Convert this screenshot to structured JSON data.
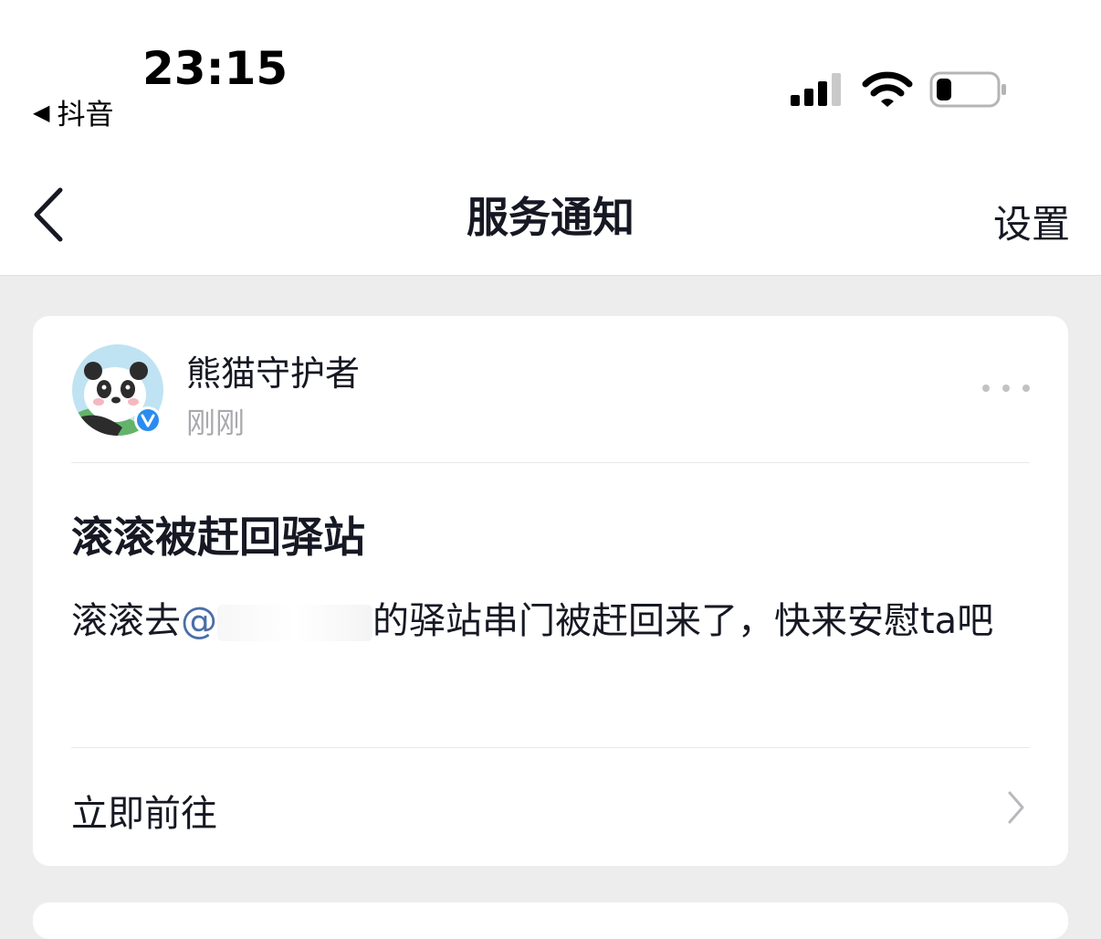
{
  "status_bar": {
    "time": "23:15",
    "back_app_label": "抖音"
  },
  "nav": {
    "title": "服务通知",
    "settings_label": "设置"
  },
  "notification": {
    "sender": "熊猫守护者",
    "time": "刚刚",
    "title": "滚滚被赶回驿站",
    "body_prefix": "滚滚去",
    "mention_symbol": "@",
    "body_suffix": "的驿站串门被赶回来了，快来安慰ta吧",
    "action_label": "立即前往"
  },
  "colors": {
    "verified_badge": "#2a8cf0",
    "mention": "#4a6ea9"
  }
}
